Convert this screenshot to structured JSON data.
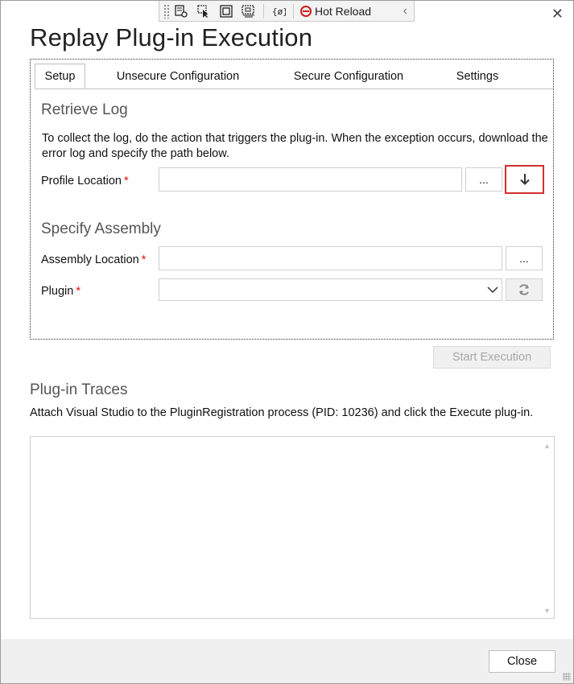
{
  "toolbar": {
    "hot_reload_label": "Hot Reload",
    "icons": [
      "live-visual-tree-icon",
      "select-element-icon",
      "display-layout-adorners-icon",
      "track-focused-element-icon",
      "binding-failures-icon",
      "stop-icon",
      "collapse-chevron-icon"
    ]
  },
  "dialog": {
    "title": "Replay Plug-in Execution",
    "close_glyph": "✕"
  },
  "tabs": [
    {
      "label": "Setup",
      "active": true
    },
    {
      "label": "Unsecure Configuration",
      "active": false
    },
    {
      "label": "Secure Configuration",
      "active": false
    },
    {
      "label": "Settings",
      "active": false
    }
  ],
  "retrieve_log": {
    "heading": "Retrieve Log",
    "description": "To collect the log, do the action that triggers the plug-in. When the exception occurs, download the error log and specify the path below.",
    "profile_location_label": "Profile Location",
    "profile_location_value": "",
    "browse_label": "...",
    "download_icon": "arrow-down-icon"
  },
  "specify_assembly": {
    "heading": "Specify Assembly",
    "assembly_location_label": "Assembly Location",
    "assembly_location_value": "",
    "browse_label": "...",
    "plugin_label": "Plugin",
    "plugin_value": "",
    "refresh_icon": "refresh-icon"
  },
  "required_marker": "*",
  "start_execution_label": "Start Execution",
  "traces": {
    "heading": "Plug-in Traces",
    "description": "Attach Visual Studio to the PluginRegistration process (PID: 10236) and click the Execute plug-in.",
    "content": ""
  },
  "footer": {
    "close_label": "Close"
  },
  "colors": {
    "required": "#dd1111",
    "download_highlight": "#d3302f",
    "footer_bg": "#f0f0f0",
    "heading_gray": "#555555"
  }
}
